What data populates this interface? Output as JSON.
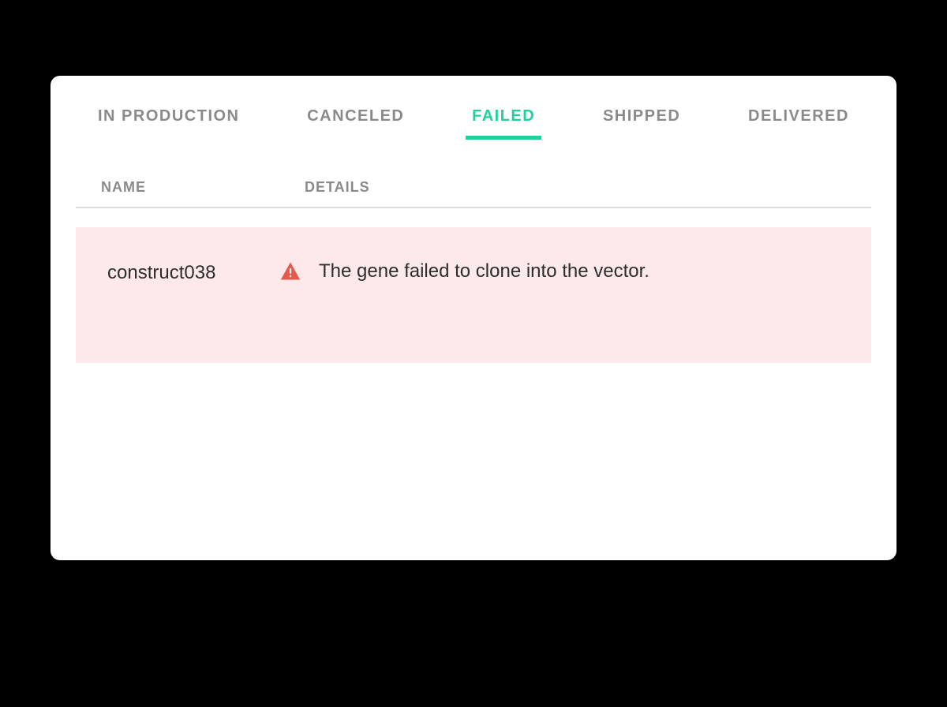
{
  "tabs": {
    "in_production": "IN PRODUCTION",
    "canceled": "CANCELED",
    "failed": "FAILED",
    "shipped": "SHIPPED",
    "delivered": "DELIVERED",
    "active": "failed"
  },
  "table": {
    "headers": {
      "name": "NAME",
      "details": "DETAILS"
    },
    "rows": [
      {
        "name": "construct038",
        "details": "The gene failed to clone into the vector."
      }
    ]
  },
  "colors": {
    "accent": "#1fd19b",
    "error": "#e35a4f",
    "error_bg": "#fde9e9",
    "text_muted": "#8a8a8a"
  }
}
